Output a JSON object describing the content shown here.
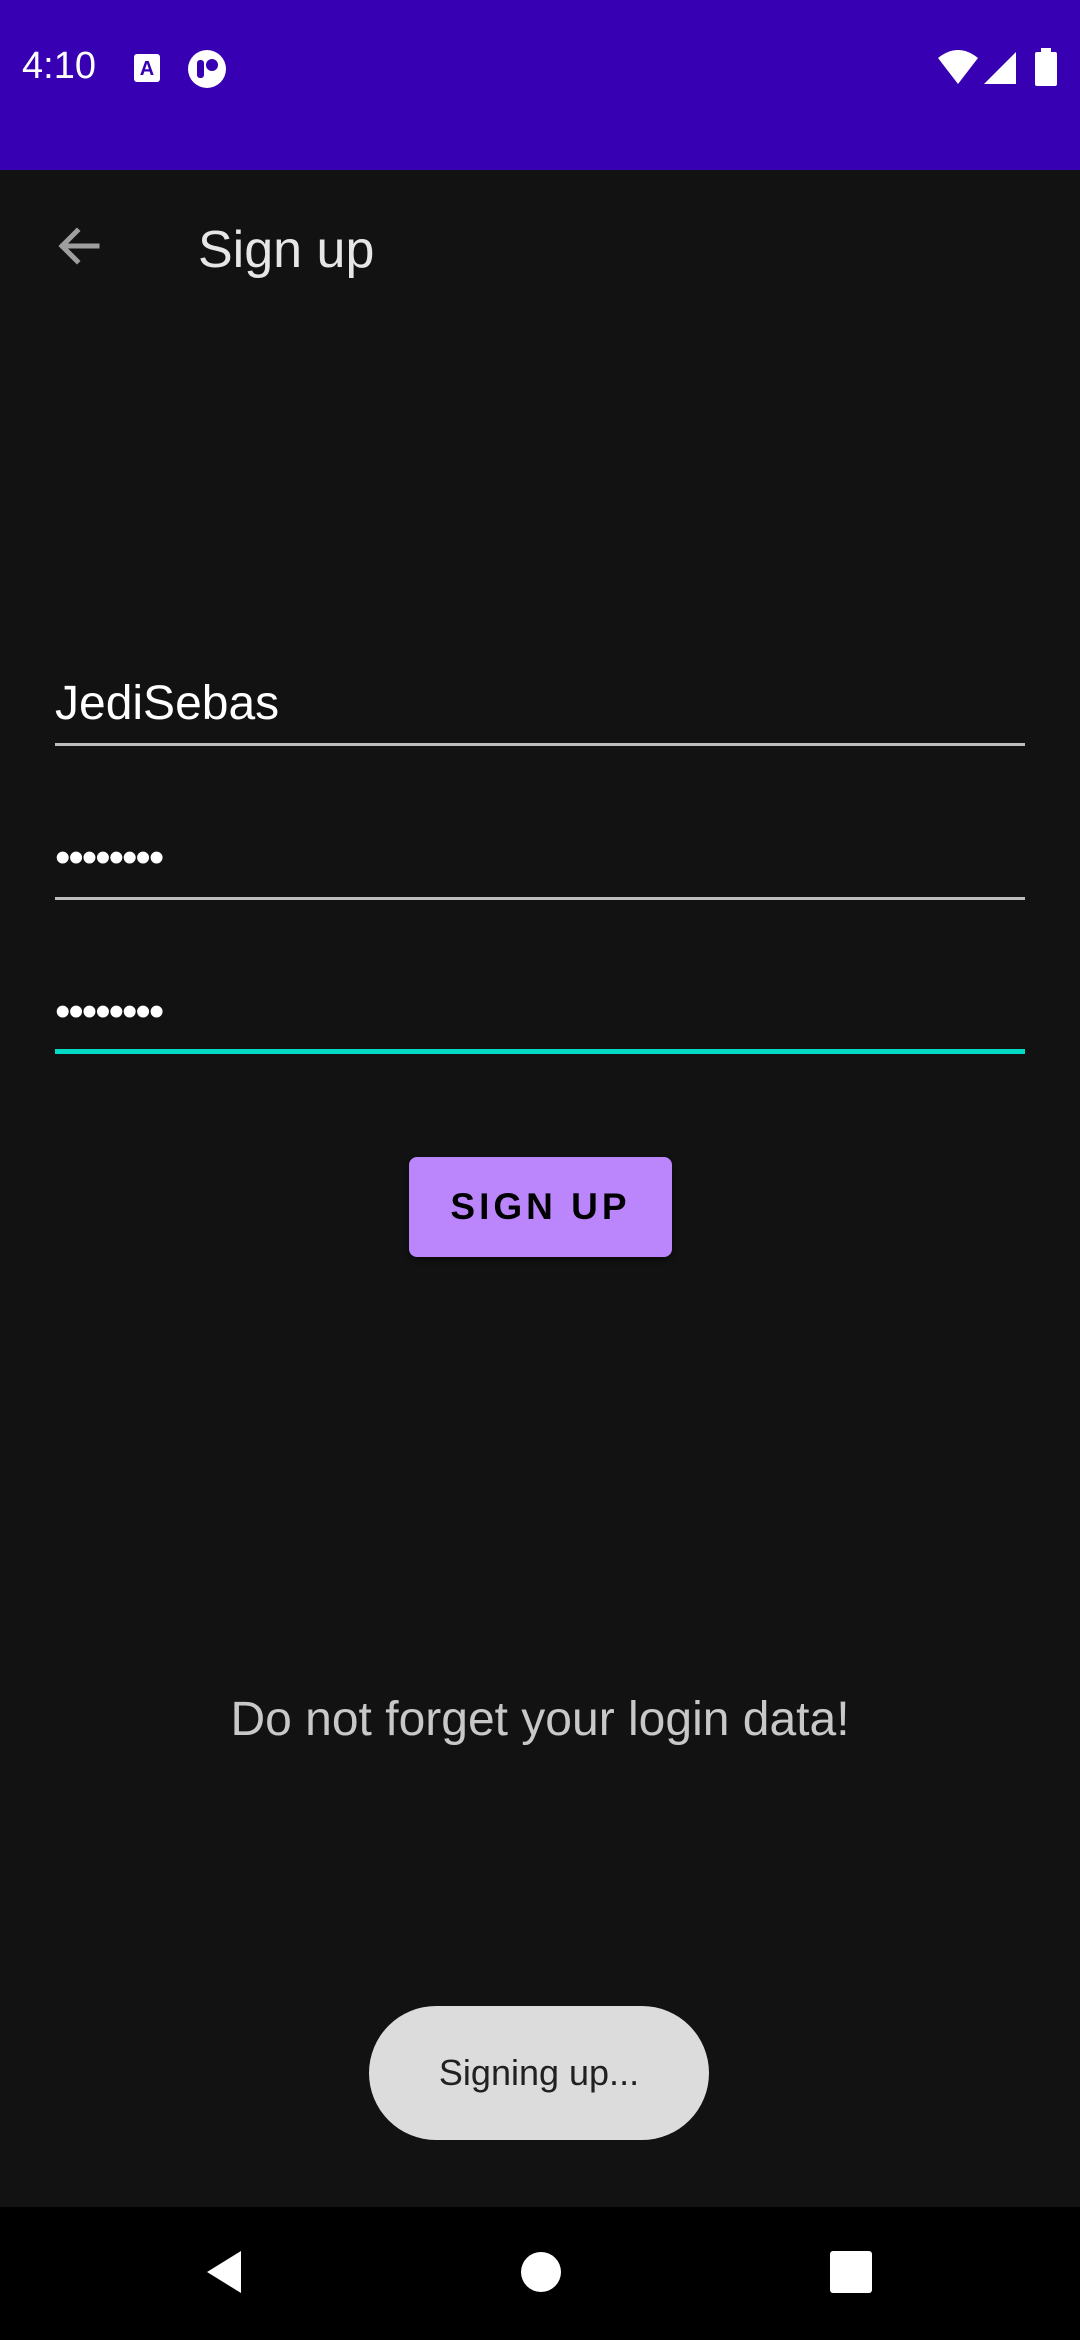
{
  "status_bar": {
    "time": "4:10",
    "background_color": "#3700B3",
    "left_icons": [
      "font-a-icon",
      "assistant-icon"
    ],
    "right_icons": [
      "wifi-icon",
      "cellular-signal-icon",
      "battery-icon"
    ]
  },
  "app_bar": {
    "title": "Sign up",
    "back_icon": "arrow-back-icon"
  },
  "form": {
    "username_value": "JediSebas",
    "password_value": "••••••••",
    "confirm_password_value": "••••••••",
    "focused_field": "confirm_password",
    "accent_color": "#03DAC5"
  },
  "actions": {
    "signup_label": "SIGN UP",
    "button_color": "#BB86FC"
  },
  "hint": {
    "text": "Do not forget your login data!"
  },
  "toast": {
    "text": "Signing up..."
  },
  "nav_bar": {
    "icons": [
      "nav-back-icon",
      "nav-home-icon",
      "nav-recents-icon"
    ]
  }
}
